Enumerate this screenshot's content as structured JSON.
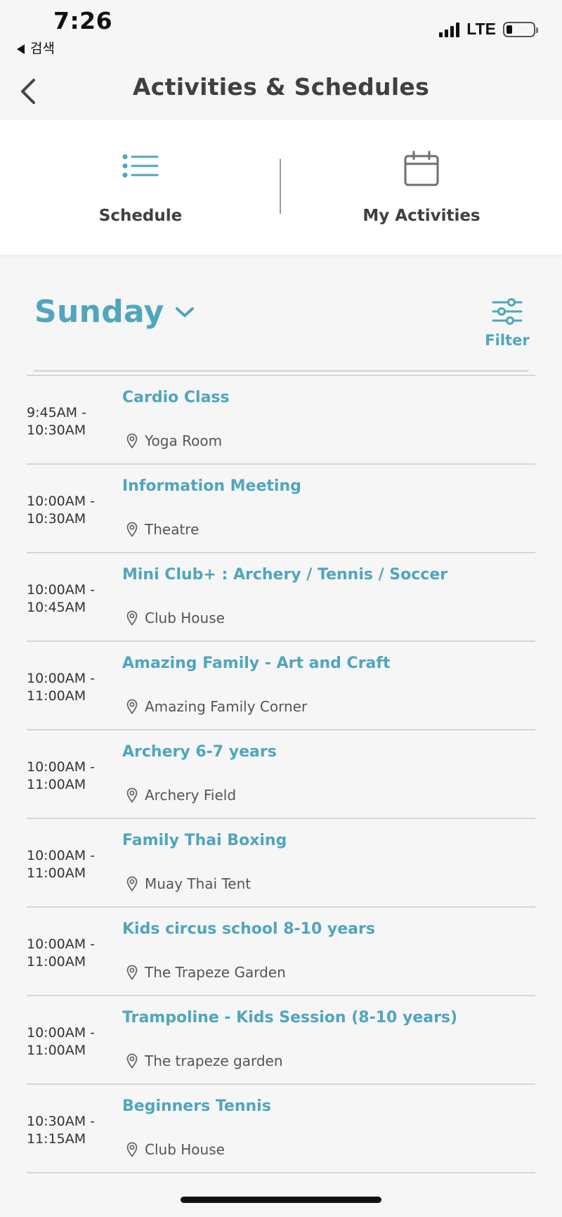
{
  "status_bar": {
    "time": "7:26",
    "back_app_label": "검색",
    "network": "LTE",
    "battery_level": 0.2
  },
  "header": {
    "title": "Activities & Schedules"
  },
  "tabs": [
    {
      "label": "Schedule",
      "icon": "list-icon",
      "active": true
    },
    {
      "label": "My Activities",
      "icon": "calendar-icon",
      "active": false
    }
  ],
  "day_selector": {
    "selected_day": "Sunday",
    "filter_label": "Filter"
  },
  "colors": {
    "accent": "#4fa6bd",
    "text": "#3f3f3f",
    "divider": "#d6d6d6"
  },
  "schedule": [
    {
      "time_start": "9:45AM -",
      "time_end": "10:30AM",
      "title": "Cardio Class",
      "location": "Yoga Room"
    },
    {
      "time_start": "10:00AM -",
      "time_end": "10:30AM",
      "title": "Information Meeting",
      "location": "Theatre"
    },
    {
      "time_start": "10:00AM -",
      "time_end": "10:45AM",
      "title": "Mini Club+ : Archery / Tennis / Soccer",
      "location": "Club House"
    },
    {
      "time_start": "10:00AM -",
      "time_end": "11:00AM",
      "title": "Amazing Family - Art and Craft",
      "location": "Amazing Family Corner"
    },
    {
      "time_start": "10:00AM -",
      "time_end": "11:00AM",
      "title": "Archery 6-7 years",
      "location": "Archery Field"
    },
    {
      "time_start": "10:00AM -",
      "time_end": "11:00AM",
      "title": "Family Thai Boxing",
      "location": "Muay Thai Tent"
    },
    {
      "time_start": "10:00AM -",
      "time_end": "11:00AM",
      "title": "Kids circus school 8-10 years",
      "location": "The Trapeze Garden"
    },
    {
      "time_start": "10:00AM -",
      "time_end": "11:00AM",
      "title": "Trampoline - Kids Session (8-10 years)",
      "location": "The trapeze garden"
    },
    {
      "time_start": "10:30AM -",
      "time_end": "11:15AM",
      "title": "Beginners Tennis",
      "location": "Club House"
    }
  ]
}
